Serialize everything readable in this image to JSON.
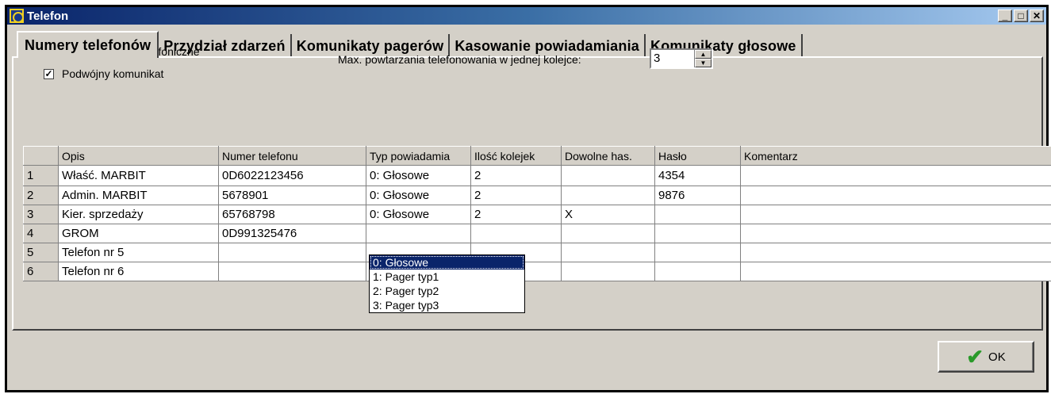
{
  "window": {
    "title": "Telefon",
    "btn_min": "_",
    "btn_max": "□",
    "btn_close": "✕"
  },
  "tabs": [
    {
      "label": "Numery telefonów"
    },
    {
      "label": "Przydział zdarzeń"
    },
    {
      "label": "Komunikaty pagerów"
    },
    {
      "label": "Kasowanie powiadamiania"
    },
    {
      "label": "Komunikaty głosowe"
    }
  ],
  "options": {
    "notify_label": "Powiadamianie telefoniczne",
    "notify_checked": true,
    "double_label": "Podwójny komunikat",
    "double_checked": true,
    "repeat_label": "Max. powtarzania telefonowania w jednej kolejce:",
    "repeat_value": "3"
  },
  "grid": {
    "columns": [
      "",
      "Opis",
      "Numer telefonu",
      "Typ powiadamia",
      "Ilość kolejek",
      "Dowolne has.",
      "Hasło",
      "Komentarz"
    ],
    "rows": [
      [
        "1",
        "Właść. MARBIT",
        "0D6022123456",
        "0: Głosowe",
        "2",
        "",
        "4354",
        ""
      ],
      [
        "2",
        "Admin. MARBIT",
        "5678901",
        "0: Głosowe",
        "2",
        "",
        "9876",
        ""
      ],
      [
        "3",
        "Kier. sprzedaży",
        "65768798",
        "0: Głosowe",
        "2",
        "X",
        "",
        ""
      ],
      [
        "4",
        "GROM",
        "0D991325476",
        "",
        "",
        "",
        "",
        ""
      ],
      [
        "5",
        "Telefon nr  5",
        "",
        "",
        "",
        "",
        "",
        ""
      ],
      [
        "6",
        "Telefon nr  6",
        "",
        "",
        "",
        "",
        "",
        ""
      ]
    ]
  },
  "dropdown": {
    "options": [
      "0: Głosowe",
      "1: Pager typ1",
      "2: Pager typ2",
      "3: Pager typ3"
    ],
    "selected_index": 0
  },
  "ok_button": {
    "label": "OK"
  },
  "icons": {
    "ok": "checkmark-icon",
    "spin_up": "arrow-up-icon",
    "spin_down": "arrow-down-icon"
  }
}
